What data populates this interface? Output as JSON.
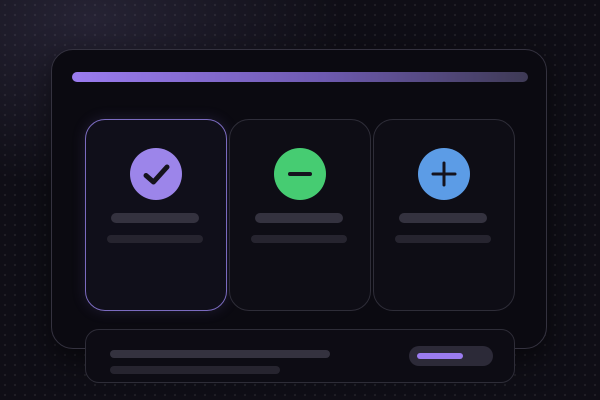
{
  "colors": {
    "accent": "#9b7cf0",
    "check_icon_bg": "#9c85ea",
    "minus_icon_bg": "#46cc72",
    "plus_icon_bg": "#5c9ce6",
    "icon_glyph": "#15131d"
  },
  "header": {
    "accent_bar": "accent-gradient"
  },
  "cards": [
    {
      "icon": "check-icon",
      "selected": true
    },
    {
      "icon": "minus-icon",
      "selected": false
    },
    {
      "icon": "plus-icon",
      "selected": false
    }
  ],
  "footer": {
    "progress": 0.68
  }
}
